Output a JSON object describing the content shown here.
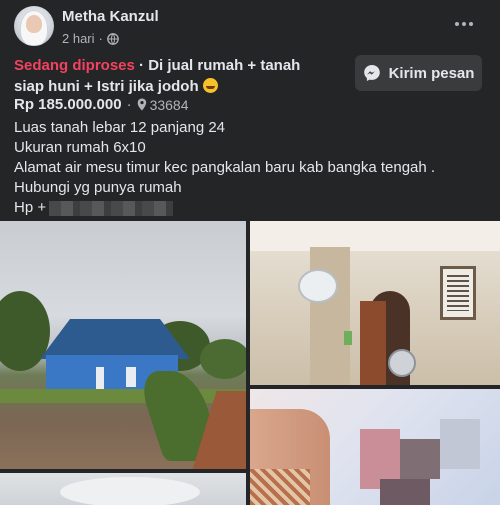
{
  "post": {
    "author": "Metha Kanzul",
    "time": "2 hari",
    "time_separator": "·",
    "privacy_icon": "globe-icon",
    "more_icon": "more-horizontal-icon"
  },
  "listing": {
    "status": "Sedang diproses",
    "status_separator": "·",
    "title": "Di jual rumah + tanah siap huni + Istri jika jodoh",
    "title_emoji": "rofl-emoji-icon",
    "price": "Rp 185.000.000",
    "price_separator": "·",
    "location": "33684",
    "location_icon": "pin-icon"
  },
  "actions": {
    "send_message_label": "Kirim pesan",
    "send_message_icon": "messenger-icon"
  },
  "description": {
    "line1": "Luas tanah lebar 12 panjang 24",
    "line2": "Ukuran rumah 6x10",
    "line3": "Alamat air mesu timur kec pangkalan baru kab bangka tengah .",
    "line4": "Hubungi yg punya rumah",
    "phone_label": "Hp +"
  },
  "colors": {
    "background": "#242526",
    "text_primary": "#e4e6eb",
    "text_secondary": "#b0b3b8",
    "status_red": "#f3425f",
    "button_bg": "#3a3b3c"
  }
}
